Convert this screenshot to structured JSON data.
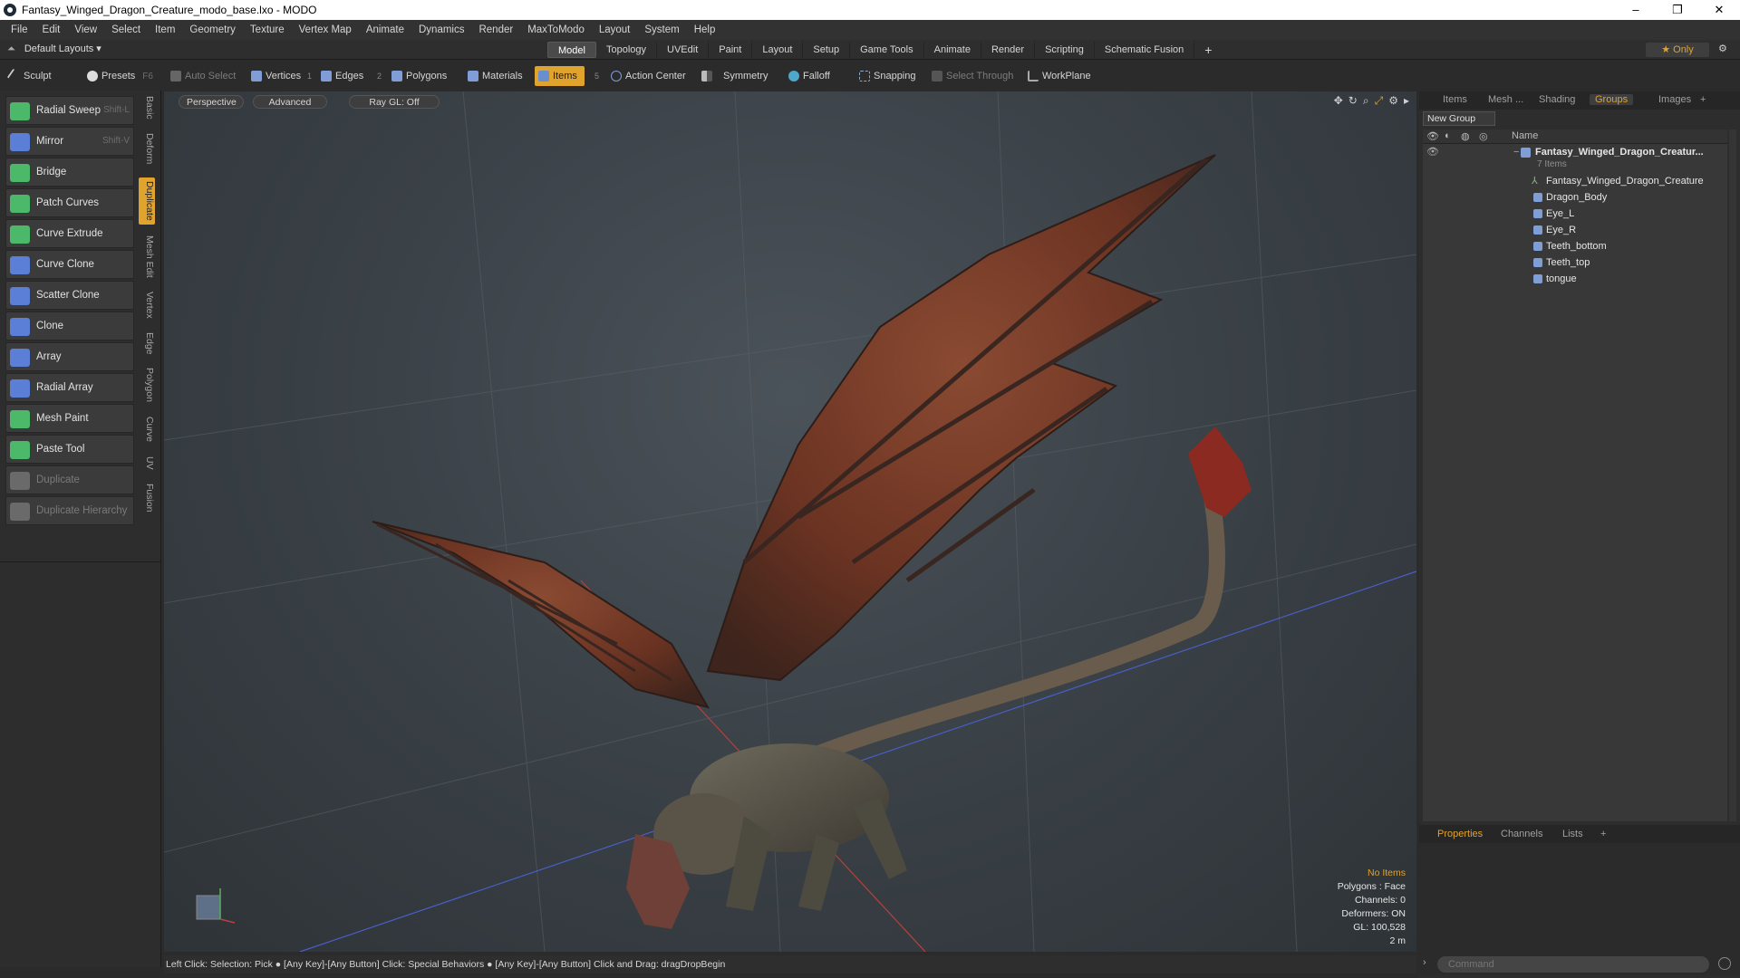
{
  "window": {
    "title": "Fantasy_Winged_Dragon_Creature_modo_base.lxo - MODO",
    "minimize": "–",
    "maximize": "❐",
    "close": "✕"
  },
  "menu": [
    "File",
    "Edit",
    "View",
    "Select",
    "Item",
    "Geometry",
    "Texture",
    "Vertex Map",
    "Animate",
    "Dynamics",
    "Render",
    "MaxToModo",
    "Layout",
    "System",
    "Help"
  ],
  "layoutbar": {
    "layouts_label": "Default Layouts ▾",
    "tabs": [
      "Model",
      "Topology",
      "UVEdit",
      "Paint",
      "Layout",
      "Setup",
      "Game Tools",
      "Animate",
      "Render",
      "Scripting",
      "Schematic Fusion"
    ],
    "active_tab": "Model",
    "add": "+",
    "only_label": "★  Only"
  },
  "toolbar": {
    "sculpt": "Sculpt",
    "presets": "Presets",
    "presets_key": "F6",
    "auto_select": "Auto Select",
    "vertices": "Vertices",
    "vertices_num": "1",
    "edges": "Edges",
    "edges_num": "2",
    "polygons": "Polygons",
    "materials": "Materials",
    "items": "Items",
    "items_num": "5",
    "action_center": "Action Center",
    "symmetry": "Symmetry",
    "falloff": "Falloff",
    "snapping": "Snapping",
    "select_through": "Select Through",
    "workplane": "WorkPlane"
  },
  "tools": [
    {
      "label": "Radial Sweep",
      "shortcut": "Shift-L",
      "icon": "radial-sweep-icon",
      "color": "#4bb86a"
    },
    {
      "label": "Mirror",
      "shortcut": "Shift-V",
      "icon": "mirror-icon",
      "color": "#5b7fd6"
    },
    {
      "label": "Bridge",
      "shortcut": "",
      "icon": "bridge-icon",
      "color": "#4bb86a"
    },
    {
      "label": "Patch Curves",
      "shortcut": "",
      "icon": "patch-curves-icon",
      "color": "#4bb86a"
    },
    {
      "label": "Curve Extrude",
      "shortcut": "",
      "icon": "curve-extrude-icon",
      "color": "#4bb86a"
    },
    {
      "label": "Curve Clone",
      "shortcut": "",
      "icon": "curve-clone-icon",
      "color": "#5b7fd6"
    },
    {
      "label": "Scatter Clone",
      "shortcut": "",
      "icon": "scatter-clone-icon",
      "color": "#5b7fd6"
    },
    {
      "label": "Clone",
      "shortcut": "",
      "icon": "clone-icon",
      "color": "#5b7fd6"
    },
    {
      "label": "Array",
      "shortcut": "",
      "icon": "array-icon",
      "color": "#5b7fd6"
    },
    {
      "label": "Radial Array",
      "shortcut": "",
      "icon": "radial-array-icon",
      "color": "#5b7fd6"
    },
    {
      "label": "Mesh Paint",
      "shortcut": "",
      "icon": "mesh-paint-icon",
      "color": "#4bb86a"
    },
    {
      "label": "Paste Tool",
      "shortcut": "",
      "icon": "paste-tool-icon",
      "color": "#4bb86a"
    },
    {
      "label": "Duplicate",
      "shortcut": "",
      "icon": "duplicate-icon",
      "color": "#6a6a6a"
    },
    {
      "label": "Duplicate Hierarchy",
      "shortcut": "",
      "icon": "duplicate-hierarchy-icon",
      "color": "#6a6a6a"
    }
  ],
  "side_tabs": [
    "Basic",
    "Deform",
    "Duplicate",
    "Mesh Edit",
    "Vertex",
    "Edge",
    "Polygon",
    "Curve",
    "UV",
    "Fusion"
  ],
  "viewport": {
    "view_mode": "Perspective",
    "shading": "Advanced",
    "raygl": "Ray GL: Off",
    "info": {
      "selection": "No Items",
      "polygons": "Polygons : Face",
      "channels": "Channels: 0",
      "deformers": "Deformers: ON",
      "gl": "GL: 100,528",
      "scale": "2 m"
    }
  },
  "status_bar": "Left Click: Selection: Pick ● [Any Key]-[Any Button] Click: Special Behaviors ● [Any Key]-[Any Button] Click and Drag: dragDropBegin",
  "right_panel": {
    "tabs": [
      "Items",
      "Mesh ...",
      "Shading",
      "Groups",
      "Images"
    ],
    "active_tab": "Groups",
    "new_group": "New Group",
    "name_header": "Name",
    "group_name": "Fantasy_Winged_Dragon_Creatur...",
    "group_count": "7 Items",
    "items": [
      "Fantasy_Winged_Dragon_Creature",
      "Dragon_Body",
      "Eye_L",
      "Eye_R",
      "Teeth_bottom",
      "Teeth_top",
      "tongue"
    ],
    "bottom_tabs": [
      "Properties",
      "Channels",
      "Lists"
    ],
    "active_bottom_tab": "Properties",
    "command_placeholder": "Command"
  },
  "colors": {
    "accent": "#e0a32e",
    "viewport_bg": "#3b4248",
    "panel_bg": "#2d2d2d"
  }
}
